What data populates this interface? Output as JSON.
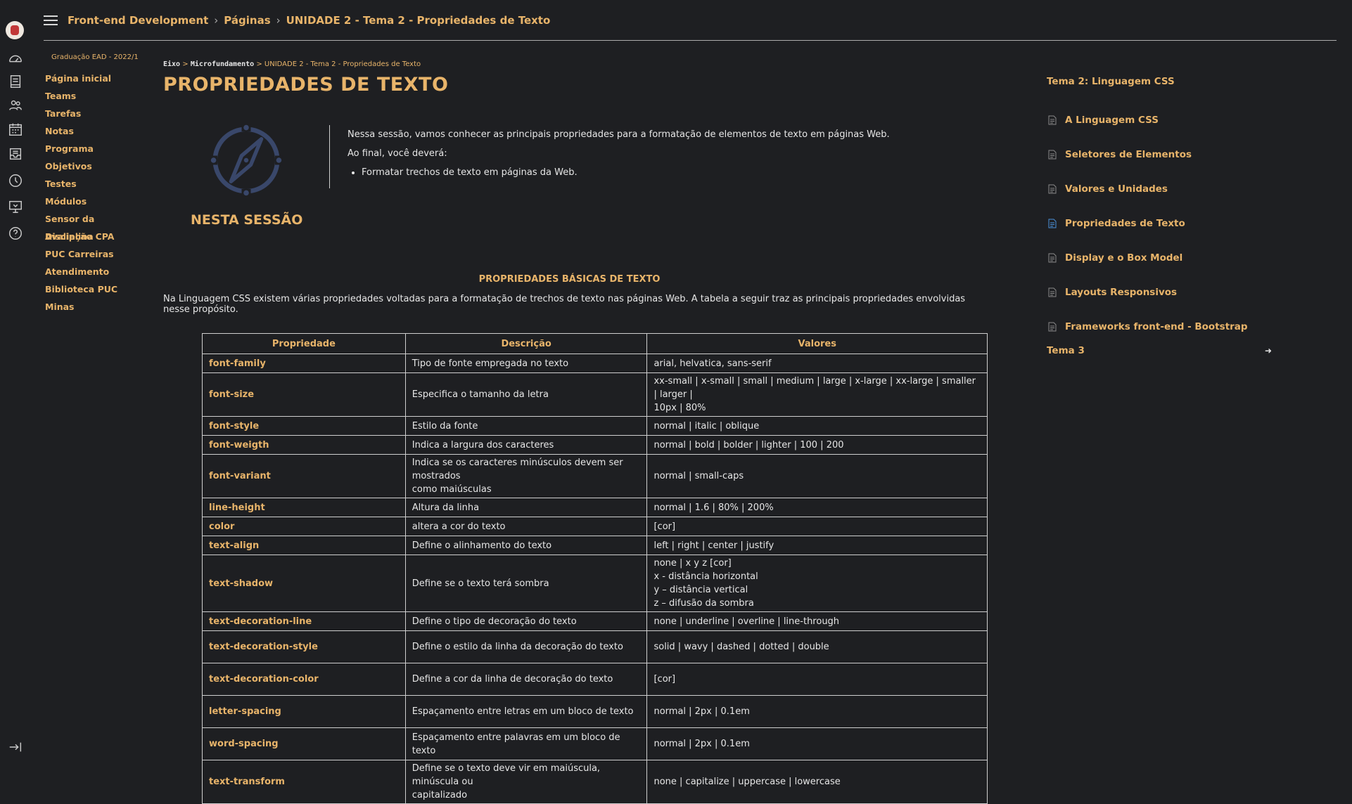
{
  "topbar": {
    "course": "Front-end Development",
    "pages": "Páginas",
    "current": "UNIDADE 2 - Tema 2 - Propriedades de Texto"
  },
  "leftnav": {
    "term": "Graduação EAD - 2022/1",
    "items": [
      "Página inicial",
      "Teams",
      "Tarefas",
      "Notas",
      "Programa",
      "Objetivos",
      "Testes",
      "Módulos",
      "Sensor da Disciplina",
      "Avaliação CPA",
      "PUC Carreiras",
      "Atendimento",
      "Biblioteca PUC Minas"
    ]
  },
  "main": {
    "crumb_eixo": "Eixo",
    "crumb_micro": "Microfundamento",
    "crumb_page": "UNIDADE 2 - Tema 2 - Propriedades de Texto",
    "title": "PROPRIEDADES DE TEXTO",
    "intro_1": "Nessa sessão, vamos conhecer as principais propriedades para a formatação de elementos de texto em páginas Web.",
    "intro_2": "Ao final, você deverá:",
    "intro_bullet": "Formatar trechos de texto em páginas da Web.",
    "nesta": "NESTA SESSÃO",
    "section_title": "PROPRIEDADES BÁSICAS DE TEXTO",
    "section_para": "Na Linguagem CSS existem várias propriedades voltadas para a formatação de trechos de texto nas páginas Web. A tabela a seguir traz as principais propriedades envolvidas nesse propósito."
  },
  "table": {
    "headers": [
      "Propriedade",
      "Descrição",
      "Valores"
    ],
    "rows": [
      {
        "prop": "font-family",
        "desc": "Tipo de fonte empregada no texto",
        "vals": "arial, helvatica, sans-serif"
      },
      {
        "prop": "font-size",
        "desc": "Especifica o tamanho da letra",
        "vals": "xx-small | x-small | small | medium | large | x-large | xx-large | smaller | larger |\n10px | 80%"
      },
      {
        "prop": "font-style",
        "desc": "Estilo da fonte",
        "vals": "normal | italic | oblique"
      },
      {
        "prop": "font-weigth",
        "desc": "Indica a largura dos caracteres",
        "vals": "normal | bold | bolder | lighter | 100 | 200"
      },
      {
        "prop": "font-variant",
        "desc": "Indica se os caracteres minúsculos devem ser mostrados\ncomo maiúsculas",
        "vals": "normal | small-caps"
      },
      {
        "prop": "line-height",
        "desc": "Altura da linha",
        "vals": "normal | 1.6 | 80% | 200%"
      },
      {
        "prop": "color",
        "desc": "altera a cor do texto",
        "vals": "[cor]"
      },
      {
        "prop": "text-align",
        "desc": "Define o alinhamento do texto",
        "vals": "left | right | center | justify"
      },
      {
        "prop": "text-shadow",
        "desc": "Define se o texto terá sombra",
        "vals": "none | x y z [cor]\nx - distância horizontal\ny – distância vertical\nz – difusão da sombra"
      },
      {
        "prop": "text-decoration-line",
        "desc": "Define o tipo de decoração do texto",
        "vals": "none | underline | overline | line-through"
      },
      {
        "prop": "text-decoration-style",
        "desc": "Define o estilo da linha da decoração do texto",
        "vals": "solid | wavy | dashed | dotted | double"
      },
      {
        "prop": "text-decoration-color",
        "desc": "Define a cor da linha de decoração do texto",
        "vals": "[cor]"
      },
      {
        "prop": "letter-spacing",
        "desc": "Espaçamento entre letras em um bloco de texto",
        "vals": "normal  | 2px | 0.1em"
      },
      {
        "prop": "word-spacing",
        "desc": "Espaçamento entre palavras em um bloco de texto",
        "vals": "normal  | 2px | 0.1em"
      },
      {
        "prop": "text-transform",
        "desc": "Define se o texto deve vir em maiúscula, minúscula ou\ncapitalizado",
        "vals": "none | capitalize | uppercase | lowercase"
      }
    ]
  },
  "rightnav": {
    "heading": "Tema 2: Linguagem CSS",
    "items": [
      "A Linguagem CSS",
      "Seletores de Elementos",
      "Valores e Unidades",
      "Propriedades de Texto",
      "Display e o Box Model",
      "Layouts Responsivos",
      "Frameworks front-end - Bootstrap"
    ],
    "tema3": "Tema 3"
  },
  "colors": {
    "accent": "#e8b46a",
    "bg": "#1e1f22",
    "active_doc": "#4a90d9"
  },
  "icons": [
    "avatar",
    "dashboard-icon",
    "courses-icon",
    "groups-icon",
    "calendar-icon",
    "inbox-icon",
    "history-icon",
    "studio-icon",
    "help-icon",
    "collapse-icon",
    "compass-icon",
    "document-icon",
    "exit-icon"
  ]
}
